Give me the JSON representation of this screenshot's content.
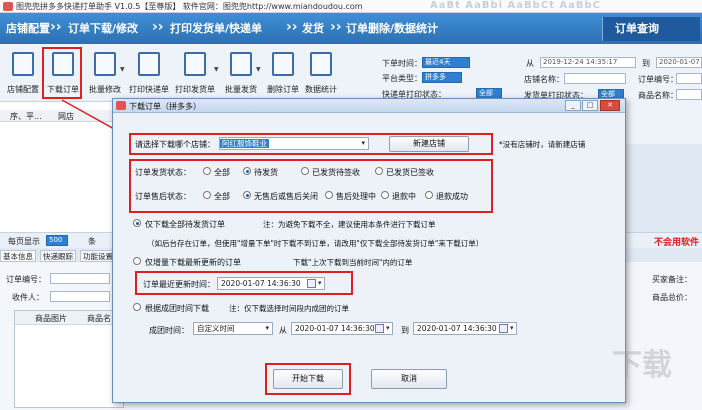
{
  "window": {
    "title": "图兜兜拼多多快递打单助手 V1.0.5【至尊版】 软件官网：图兜兜http://www.miandoudou.com",
    "watermark_text": "AaBt AaBbi AaBbCt AaBbC"
  },
  "flow": {
    "steps": [
      "店铺配置",
      "订单下载/修改",
      "打印发货单/快递单",
      "发货",
      "订单删除/数据统计"
    ],
    "query_label": "订单查询"
  },
  "toolbar": {
    "buttons": [
      {
        "label": "店铺配置",
        "icon": "sliders-icon"
      },
      {
        "label": "下载订单",
        "icon": "clipboard-edit-icon"
      },
      {
        "label": "批量修改",
        "icon": "document-edit-icon"
      },
      {
        "label": "打印快递单",
        "icon": "printer-icon"
      },
      {
        "label": "打印发货单",
        "icon": "printer-icon"
      },
      {
        "label": "批量发货",
        "icon": "box-icon"
      },
      {
        "label": "删除订单",
        "icon": "delete-icon"
      },
      {
        "label": "数据统计",
        "icon": "chart-icon"
      }
    ]
  },
  "filters": {
    "order_time_label": "下单时间：",
    "order_time_select": "最近4天",
    "order_time_from_label": "从",
    "order_time_from": "2019-12-24 14:35:17",
    "order_time_to_label": "到",
    "order_time_to": "2020-01-07 1",
    "platform_label": "平台类型：",
    "platform_value": "拼多多",
    "shop_name_label": "店铺名称：",
    "order_no_label": "订单编号：",
    "express_status_label": "快递单打印状态：",
    "express_status_value": "全部",
    "ship_status_label": "发货单打印状态：",
    "ship_status_value": "全部",
    "goods_name_label": "商品名称："
  },
  "grid": {
    "headers": [
      "序、平...",
      "网店"
    ]
  },
  "pagebar": {
    "page_size_label": "每页显示",
    "page_size_value": "500",
    "unit": "条",
    "notice": "不会用软件"
  },
  "tabs": [
    "基本信息",
    "快递跟踪",
    "功能设置"
  ],
  "detail": {
    "order_no_label": "订单编号：",
    "receiver_label": "收件人：",
    "buyer_note_label": "买家备注：",
    "goods_total_label": "商品总价：",
    "subtable_headers": [
      "商品图片",
      "商品名"
    ]
  },
  "dialog": {
    "title": "下载订单（拼多多）",
    "shop_select_label": "请选择下载哪个店铺：",
    "shop_select_value": "阿红服饰鞋业",
    "new_shop_button": "新建店铺",
    "new_shop_hint": "*没有店铺时，请新建店铺",
    "ship_status_label": "订单发货状态：",
    "ship_status_options": [
      "全部",
      "待发货",
      "已发货待签收",
      "已发货已签收"
    ],
    "aftersale_label": "订单售后状态：",
    "aftersale_options": [
      "全部",
      "无售后或售后关闭",
      "售后处理中",
      "退款中",
      "退款成功"
    ],
    "mode1_label": "仅下载全部待发货订单",
    "mode1_hint": "注：为避免下载不全，建议使用本条件进行下载订单",
    "mode1_note": "（如后台存在订单，但使用\"增量下单\"时下载不到订单，请改用\"仅下载全部待发货订单\"来下载订单）",
    "mode2_label": "仅增量下载最新更新的订单",
    "mode2_hint": "下载\"上次下载到当前时间\"内的订单",
    "last_update_label": "订单最近更新时间：",
    "last_update_value": "2020-01-07 14:36:30",
    "mode3_label": "根据成团时间下载",
    "mode3_hint": "注：仅下载选择时间段内成团的订单",
    "group_time_label": "成团时间：",
    "group_time_select": "自定义时间",
    "from_label": "从",
    "from_value": "2020-01-07 14:36:30",
    "to_label": "到",
    "to_value": "2020-01-07 14:36:30",
    "start_button": "开始下载",
    "cancel_button": "取消"
  },
  "colors": {
    "accent": "#2d6fb4",
    "highlight": "#e02020"
  }
}
